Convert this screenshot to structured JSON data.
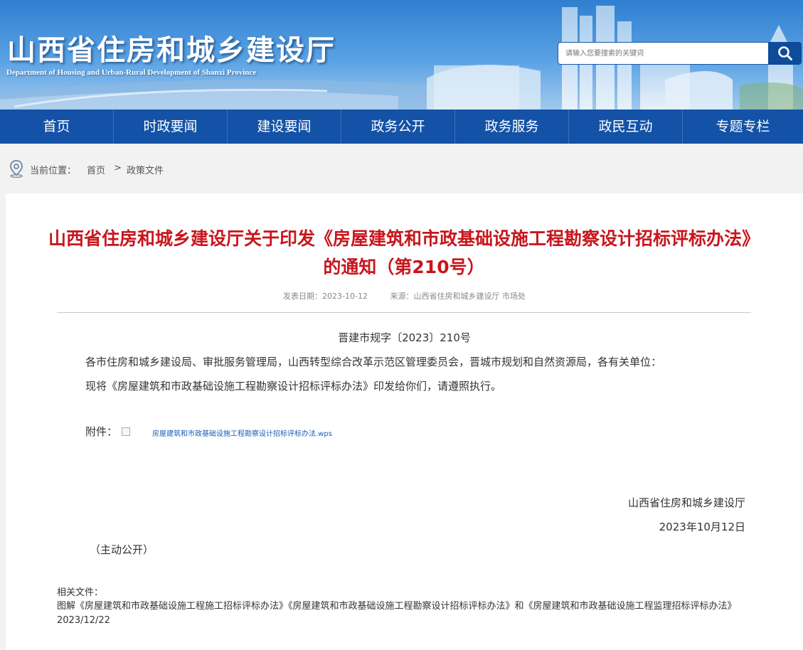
{
  "header": {
    "title": "山西省住房和城乡建设厅",
    "subtitle": "Department of Housing and Urban-Rural Development of Shanxi Province",
    "search_placeholder": "请输入您要搜索的关键词",
    "search_icon": "search-icon"
  },
  "nav": {
    "items": [
      {
        "label": "首页"
      },
      {
        "label": "时政要闻"
      },
      {
        "label": "建设要闻"
      },
      {
        "label": "政务公开"
      },
      {
        "label": "政务服务"
      },
      {
        "label": "政民互动"
      },
      {
        "label": "专题专栏"
      }
    ]
  },
  "breadcrumb": {
    "label": "当前位置：",
    "items": [
      "首页",
      "政策文件"
    ],
    "separator": ">",
    "icon": "location-pin-icon"
  },
  "article": {
    "title": "山西省住房和城乡建设厅关于印发《房屋建筑和市政基础设施工程勘察设计招标评标办法》的通知（第210号）",
    "date_label": "发表日期：",
    "date": "2023-10-12",
    "source_label": "来源：",
    "source": "山西省住房和城乡建设厅 市场处",
    "doc_number": "晋建市规字〔2023〕210号",
    "recipients": "各市住房和城乡建设局、审批服务管理局，山西转型综合改革示范区管理委员会，晋城市规划和自然资源局，各有关单位：",
    "body": "现将《房屋建筑和市政基础设施工程勘察设计招标评标办法》印发给你们，请遵照执行。",
    "attachment_label": "附件：",
    "attachment_name": "房屋建筑和市政基础设施工程勘察设计招标评标办法.wps",
    "signer": "山西省住房和城乡建设厅",
    "sign_date": "2023年10月12日",
    "disclosure": "（主动公开）"
  },
  "related": {
    "heading": "相关文件：",
    "items": [
      "图解《房屋建筑和市政基础设施工程施工招标评标办法》《房屋建筑和市政基础设施工程勘察设计招标评标办法》和《房屋建筑和市政基础设施工程监理招标评标办法》 2023/12/22"
    ]
  },
  "colors": {
    "nav_bg": "#1352a6",
    "title_red": "#c8161d",
    "search_button": "#0e4b9b"
  }
}
